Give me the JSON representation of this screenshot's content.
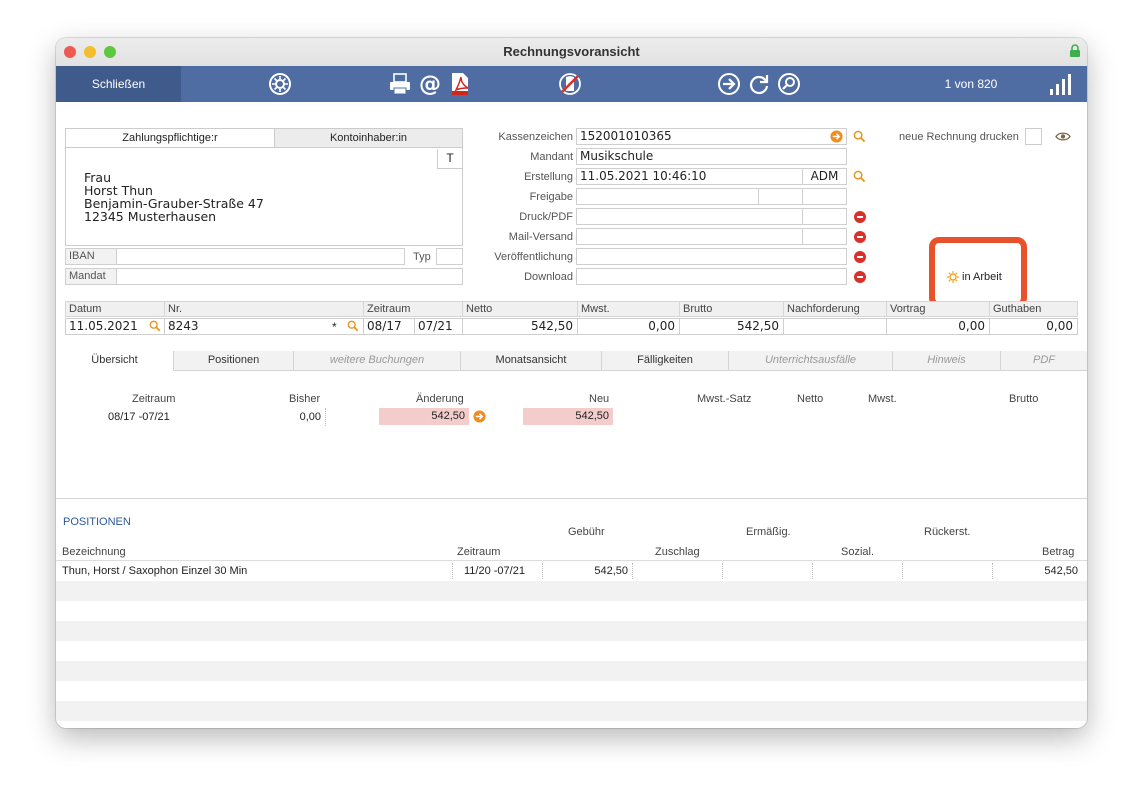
{
  "window": {
    "title": "Rechnungsvoransicht"
  },
  "toolbar": {
    "close_label": "Schließen",
    "counter": "1 von 820",
    "icons": [
      "gear-icon",
      "printer-icon",
      "email-icon",
      "pdf-icon",
      "cancel-icon",
      "next-icon",
      "refresh-icon",
      "search-icon",
      "signal-icon"
    ]
  },
  "address": {
    "tab_payer": "Zahlungspflichtige:r",
    "tab_holder": "Kontoinhaber:in",
    "t_button": "T",
    "lines": [
      "Frau",
      "Horst Thun",
      "Benjamin-Grauber-Straße 47",
      "12345 Musterhausen"
    ],
    "iban_label": "IBAN",
    "iban_value": "",
    "typ_label": "Typ",
    "typ_value": "",
    "mandat_label": "Mandat",
    "mandat_value": ""
  },
  "invoice": {
    "kassenzeichen_label": "Kassenzeichen",
    "kassenzeichen": "152001010365",
    "mandant_label": "Mandant",
    "mandant": "Musikschule",
    "erstellung_label": "Erstellung",
    "erstellung": "11.05.2021 10:46:10",
    "erstellung_user": "ADM",
    "freigabe_label": "Freigabe",
    "druck_label": "Druck/PDF",
    "mail_label": "Mail-Versand",
    "veroeff_label": "Veröffentlichung",
    "download_label": "Download",
    "print_new_label": "neue Rechnung drucken",
    "status": "in Arbeit"
  },
  "summary": {
    "headers": [
      "Datum",
      "Nr.",
      "Zeitraum",
      "Netto",
      "Mwst.",
      "Brutto",
      "Nachforderung",
      "Vortrag",
      "Guthaben"
    ],
    "datum": "11.05.2021",
    "nr": "8243",
    "nr_flag": "*",
    "zeitraum_from": "08/17",
    "zeitraum_to": "07/21",
    "netto": "542,50",
    "mwst": "0,00",
    "brutto": "542,50",
    "nachforderung": "",
    "vortrag": "0,00",
    "guthaben": "0,00"
  },
  "tabs": [
    {
      "label": "Übersicht",
      "active": true,
      "disabled": false
    },
    {
      "label": "Positionen",
      "active": false,
      "disabled": false
    },
    {
      "label": "weitere Buchungen",
      "active": false,
      "disabled": true
    },
    {
      "label": "Monatsansicht",
      "active": false,
      "disabled": false
    },
    {
      "label": "Fälligkeiten",
      "active": false,
      "disabled": false
    },
    {
      "label": "Unterrichtsausfälle",
      "active": false,
      "disabled": true
    },
    {
      "label": "Hinweis",
      "active": false,
      "disabled": true
    },
    {
      "label": "PDF",
      "active": false,
      "disabled": true
    }
  ],
  "overview": {
    "headers": {
      "zeitraum": "Zeitraum",
      "bisher": "Bisher",
      "aenderung": "Änderung",
      "neu": "Neu",
      "mwst_satz": "Mwst.-Satz",
      "netto": "Netto",
      "mwst": "Mwst.",
      "brutto": "Brutto"
    },
    "row": {
      "zeitraum": "08/17 -07/21",
      "bisher": "0,00",
      "aenderung": "542,50",
      "neu": "542,50"
    }
  },
  "positions": {
    "title": "POSITIONEN",
    "headers": {
      "gebuehr": "Gebühr",
      "ermaessig": "Ermäßig.",
      "rueckerst": "Rückerst.",
      "bezeichnung": "Bezeichnung",
      "zeitraum": "Zeitraum",
      "zuschlag": "Zuschlag",
      "sozial": "Sozial.",
      "betrag": "Betrag"
    },
    "rows": [
      {
        "bezeichnung": "Thun, Horst / Saxophon Einzel 30 Min",
        "zeitraum": "11/20 -07/21",
        "gebuehr": "542,50",
        "betrag": "542,50"
      }
    ]
  }
}
